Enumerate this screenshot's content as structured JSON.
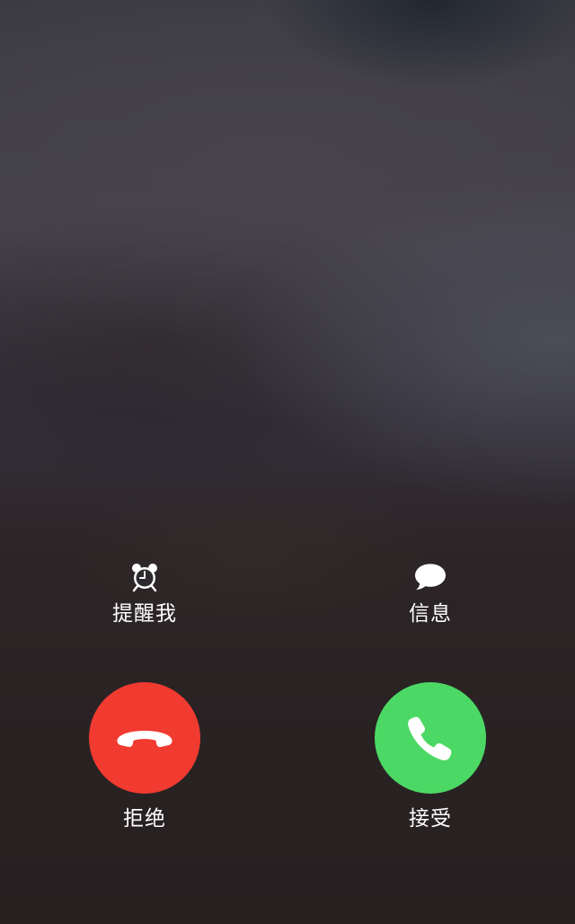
{
  "incoming_call": {
    "remind_me": {
      "label": "提醒我",
      "icon": "alarm-clock-icon"
    },
    "message": {
      "label": "信息",
      "icon": "speech-bubble-icon"
    },
    "decline": {
      "label": "拒绝",
      "icon": "phone-hangup-icon",
      "color": "#f13a30"
    },
    "accept": {
      "label": "接受",
      "icon": "phone-icon",
      "color": "#4cd864"
    }
  }
}
